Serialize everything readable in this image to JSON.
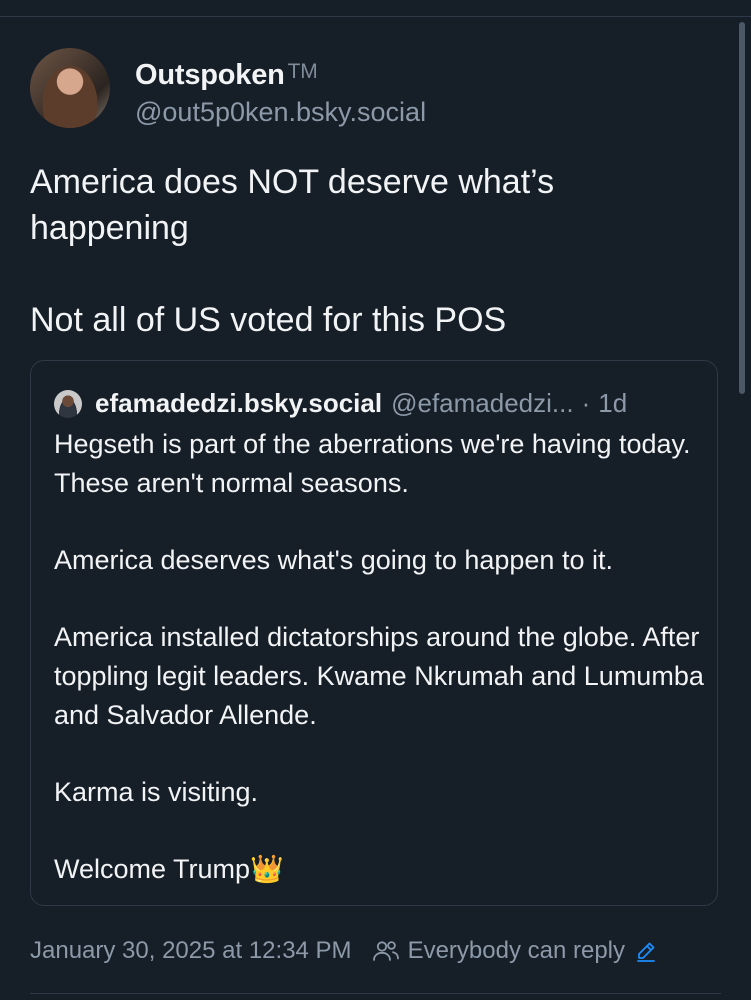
{
  "post": {
    "display_name": "Outspoken",
    "tm": "TM",
    "handle": "@out5p0ken.bsky.social",
    "text_paragraph_1": "America does NOT deserve what’s happening",
    "text_paragraph_2": "Not all of US voted for this POS"
  },
  "quote": {
    "display_name": "efamadedzi.bsky.social",
    "handle": "@efamadedzi...",
    "separator": "·",
    "time": "1d",
    "paragraphs": [
      "Hegseth is part of the aberrations we're having today. These aren't normal seasons.",
      "America deserves what's going to happen to it.",
      "America installed dictatorships around the globe. After toppling legit leaders. Kwame Nkrumah and Lumumba and Salvador Allende.",
      "Karma is visiting.",
      "Welcome Trump👑"
    ]
  },
  "footer": {
    "timestamp": "January 30, 2025 at 12:34 PM",
    "reply_setting": "Everybody can reply",
    "reply_icon": "people-icon",
    "edit_icon": "pencil-icon"
  },
  "colors": {
    "background": "#161e27",
    "text": "#f1f3f5",
    "muted": "#8c99a8",
    "border": "#2e3a47",
    "accent": "#1d8cf8"
  }
}
